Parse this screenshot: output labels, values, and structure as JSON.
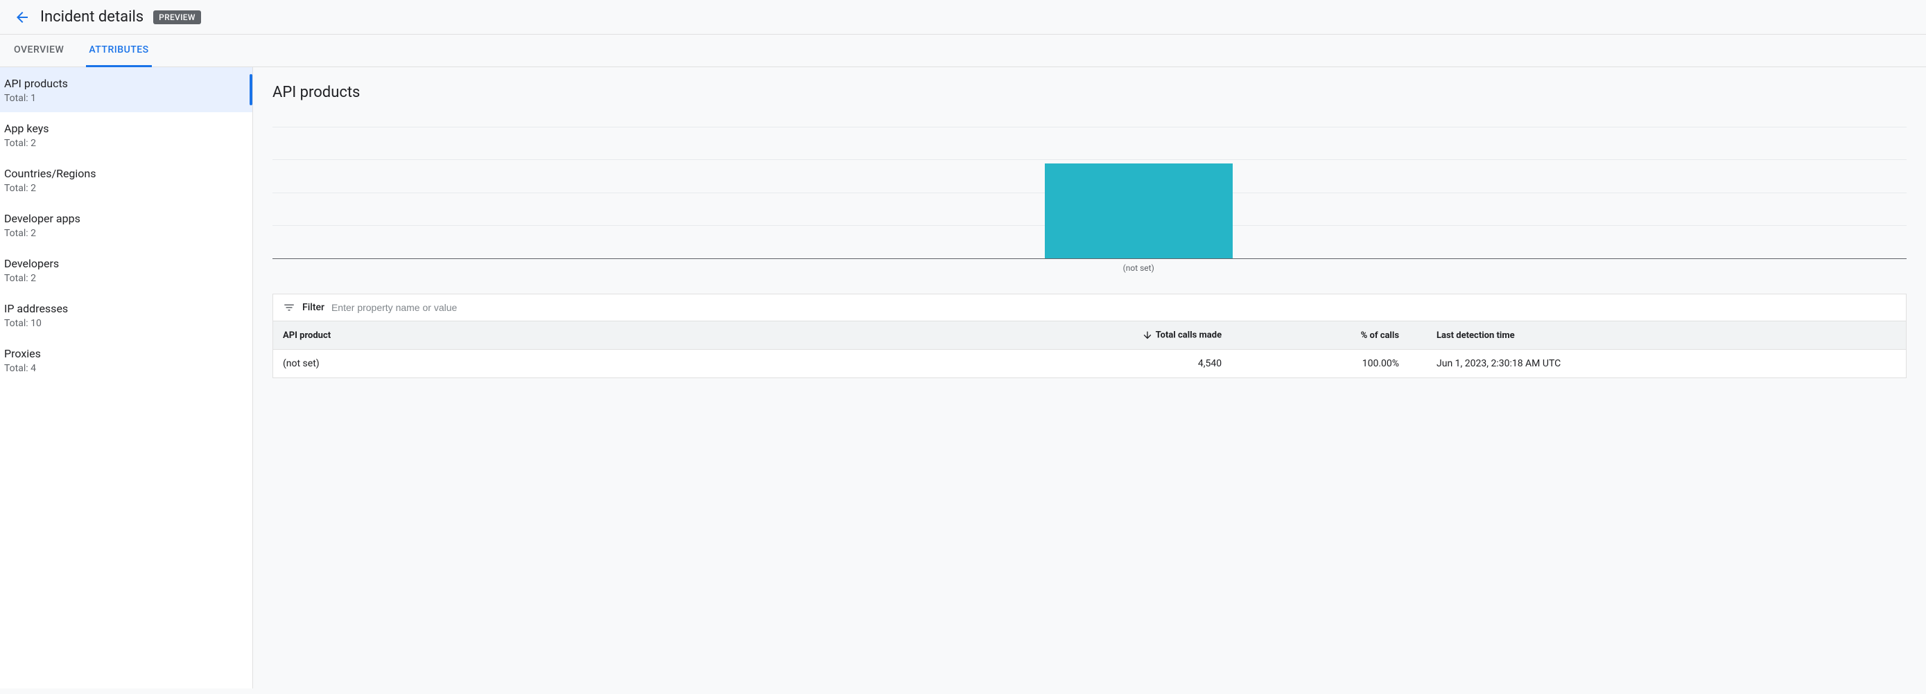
{
  "header": {
    "title": "Incident details",
    "badge": "PREVIEW"
  },
  "tabs": [
    {
      "label": "OVERVIEW",
      "active": false
    },
    {
      "label": "ATTRIBUTES",
      "active": true
    }
  ],
  "sidebar": {
    "total_prefix": "Total: ",
    "items": [
      {
        "label": "API products",
        "total": "1",
        "active": true
      },
      {
        "label": "App keys",
        "total": "2",
        "active": false
      },
      {
        "label": "Countries/Regions",
        "total": "2",
        "active": false
      },
      {
        "label": "Developer apps",
        "total": "2",
        "active": false
      },
      {
        "label": "Developers",
        "total": "2",
        "active": false
      },
      {
        "label": "IP addresses",
        "total": "10",
        "active": false
      },
      {
        "label": "Proxies",
        "total": "4",
        "active": false
      }
    ]
  },
  "main": {
    "section_title": "API products",
    "filter": {
      "label": "Filter",
      "placeholder": "Enter property name or value"
    },
    "table": {
      "columns": {
        "product": "API product",
        "calls": "Total calls made",
        "pct": "% of calls",
        "last": "Last detection time"
      },
      "rows": [
        {
          "product": "(not set)",
          "calls": "4,540",
          "pct": "100.00%",
          "last": "Jun 1, 2023, 2:30:18 AM UTC"
        }
      ]
    }
  },
  "chart_data": {
    "type": "bar",
    "categories": [
      "(not set)"
    ],
    "values": [
      4540
    ],
    "title": "",
    "xlabel": "",
    "ylabel": "",
    "ylim": [
      0,
      5000
    ]
  }
}
